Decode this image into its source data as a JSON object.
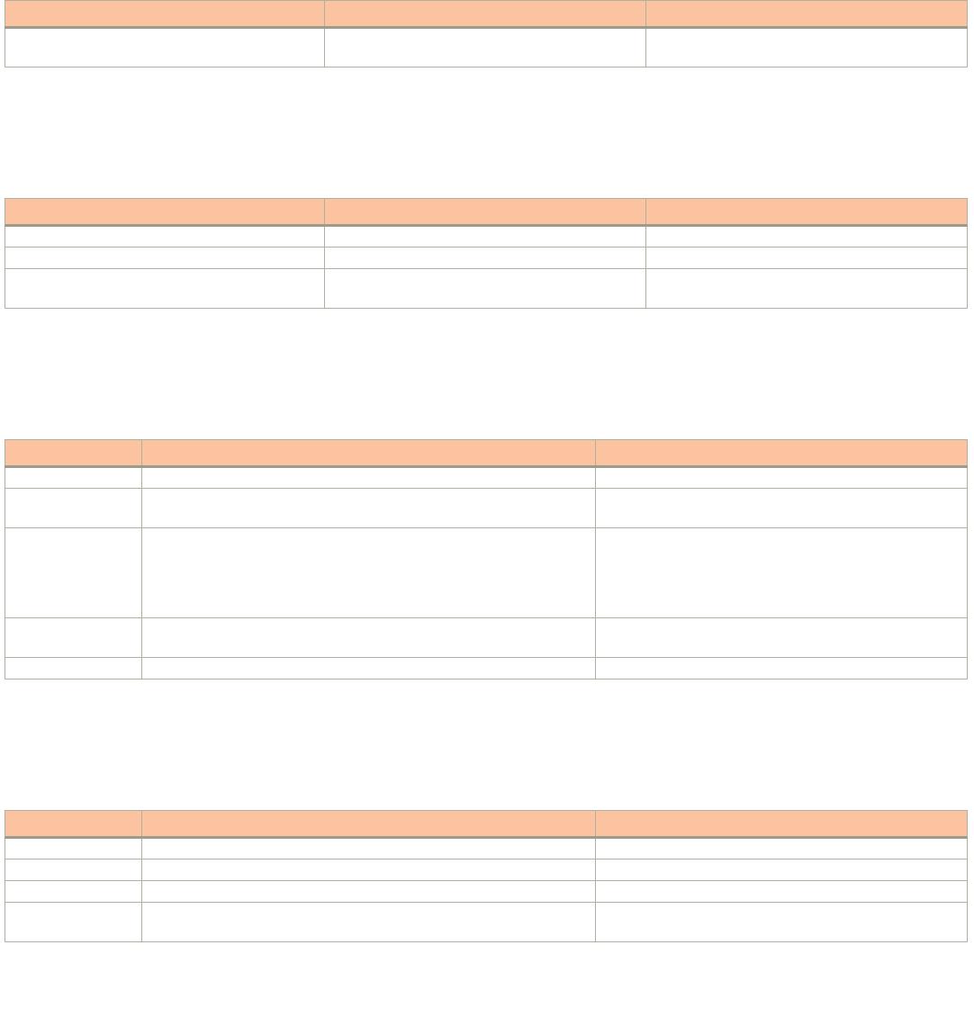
{
  "table1": {
    "headers": [
      "",
      "",
      ""
    ],
    "rows": [
      [
        "",
        "",
        ""
      ]
    ]
  },
  "table2": {
    "headers": [
      "",
      "",
      ""
    ],
    "rows": [
      [
        "",
        "",
        ""
      ],
      [
        "",
        "",
        ""
      ],
      [
        "",
        "",
        ""
      ]
    ]
  },
  "table3": {
    "headers": [
      "",
      "",
      ""
    ],
    "rows": [
      [
        "",
        "",
        ""
      ],
      [
        "",
        "",
        ""
      ],
      [
        "",
        "",
        ""
      ],
      [
        "",
        "",
        ""
      ],
      [
        "",
        "",
        ""
      ]
    ]
  },
  "table4": {
    "headers": [
      "",
      "",
      ""
    ],
    "rows": [
      [
        "",
        "",
        ""
      ],
      [
        "",
        "",
        ""
      ],
      [
        "",
        "",
        ""
      ],
      [
        "",
        "",
        ""
      ]
    ]
  }
}
